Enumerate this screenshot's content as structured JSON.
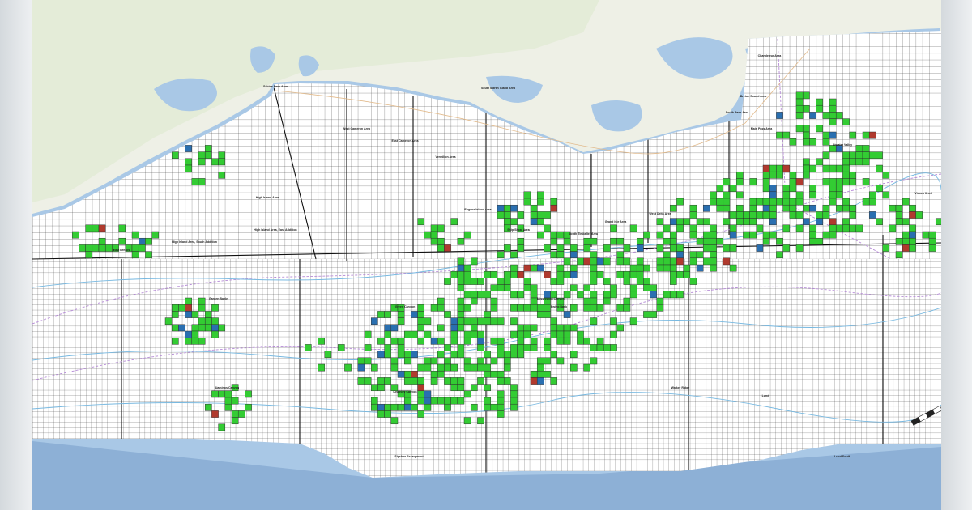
{
  "map": {
    "colors": {
      "water": "#a9c8e6",
      "deep_water": "#8db0d6",
      "land": "#eef0e6",
      "land_green": "#dfe9d2",
      "grid_line": "#2b2b2b",
      "grid_fill": "#ffffff",
      "lease_active": "#33cc33",
      "lease_blue": "#2a6fb0",
      "lease_red": "#b03a2e",
      "contour": "#77b8e0",
      "boundary_purple": "#b58ad6",
      "boundary_orange": "#e1b98a"
    },
    "area_labels": [
      "Sabine Pass Area",
      "High Island Area",
      "High Island Area, East Addition",
      "High Island Area, South Addition",
      "West Cameron Area",
      "East Cameron Area",
      "Vermilion Area",
      "South Marsh Island Area",
      "Eugene Island Area",
      "Ship Shoal Area",
      "South Timbalier Area",
      "Grand Isle Area",
      "West Delta Area",
      "South Pass Area",
      "Main Pass Area",
      "Breton Sound Area",
      "Chandeleur Area",
      "Mississippi Canyon",
      "Green Canyon",
      "Garden Banks",
      "East Breaks",
      "Alaminos Canyon",
      "Keathley Canyon",
      "Walker Ridge",
      "Atwater Valley",
      "Ewing Bank",
      "Viosca Knoll",
      "Sigsbee Escarpment",
      "Lund",
      "Lund South"
    ]
  }
}
